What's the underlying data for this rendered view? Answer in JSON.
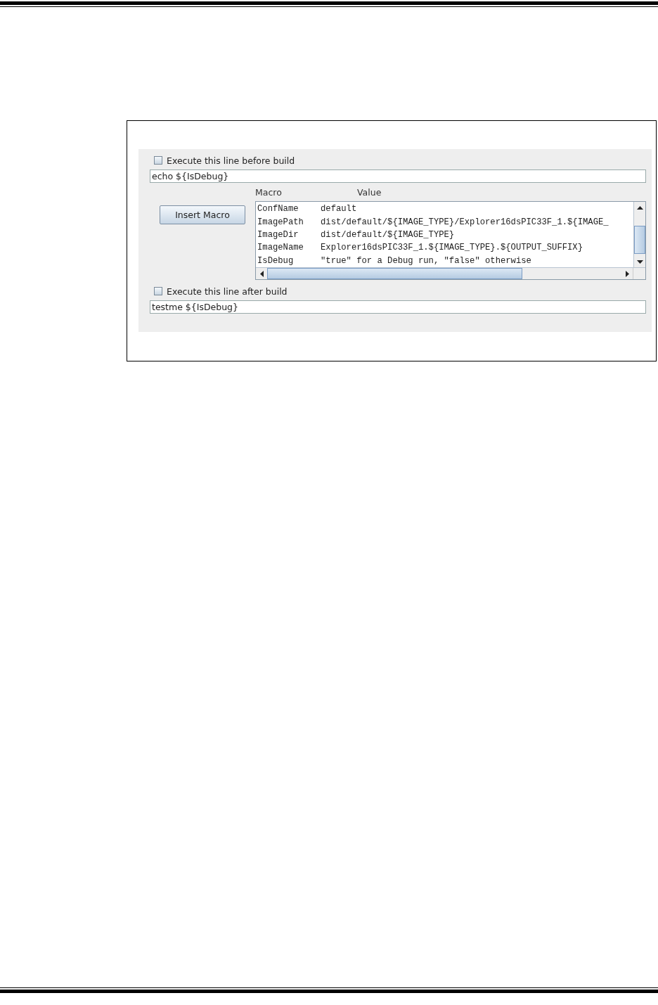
{
  "before_build": {
    "checkbox_label": "Execute this line before build",
    "checked": false,
    "command": "echo ${IsDebug}"
  },
  "insert_macro_button": "Insert Macro",
  "macro_table": {
    "columns": [
      "Macro",
      "Value"
    ],
    "rows": [
      {
        "macro": "ConfName",
        "value": "default"
      },
      {
        "macro": "ImagePath",
        "value": "dist/default/${IMAGE_TYPE}/Explorer16dsPIC33F_1.${IMAGE_"
      },
      {
        "macro": "ImageDir",
        "value": "dist/default/${IMAGE_TYPE}"
      },
      {
        "macro": "ImageName",
        "value": "Explorer16dsPIC33F_1.${IMAGE_TYPE}.${OUTPUT_SUFFIX}"
      },
      {
        "macro": "IsDebug",
        "value": "\"true\" for a Debug run, \"false\" otherwise"
      }
    ]
  },
  "after_build": {
    "checkbox_label": "Execute this line after build",
    "checked": false,
    "command": "testme ${IsDebug}"
  }
}
